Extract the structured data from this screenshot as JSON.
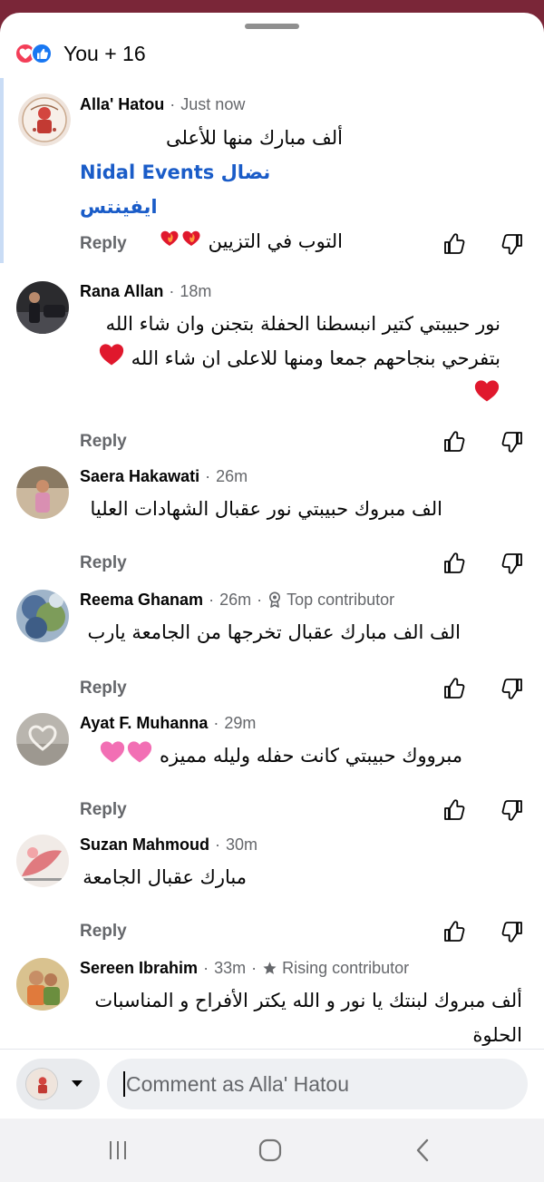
{
  "header": {
    "reactions_text": "You + 16",
    "reaction_icons": [
      "love-icon",
      "like-icon"
    ]
  },
  "comments": [
    {
      "author": "Alla' Hatou",
      "time": "Just now",
      "lines": [
        "ألف مبارك منها للأعلى"
      ],
      "mention": "Nidal Events نضال ايفينتس",
      "line_after": "التوب في التزيين",
      "emoji": [
        "❤️‍🔥",
        "❤️‍🔥"
      ],
      "reply": "Reply",
      "highlighted": true
    },
    {
      "author": "Rana Allan",
      "time": "18m",
      "lines": [
        "نور حبيبتي كتير انبسطنا الحفلة بتجنن وان شاء الله",
        "بتفرحي بنجاحهم جمعا ومنها للاعلى ان شاء الله"
      ],
      "emoji": [
        "❤️",
        "❤️"
      ],
      "reply": "Reply"
    },
    {
      "author": "Saera Hakawati",
      "time": "26m",
      "lines": [
        "الف مبروك حبيبتي نور عقبال الشهادات العليا"
      ],
      "reply": "Reply"
    },
    {
      "author": "Reema Ghanam",
      "time": "26m",
      "badge": "Top contributor",
      "lines": [
        "الف الف مبارك عقبال تخرجها من الجامعة يارب"
      ],
      "reply": "Reply"
    },
    {
      "author": "Ayat F. Muhanna",
      "time": "29m",
      "lines": [
        "مبرووك حبيبتي كانت حفله وليله مميزه"
      ],
      "emoji": [
        "💗",
        "💗"
      ],
      "reply": "Reply"
    },
    {
      "author": "Suzan Mahmoud",
      "time": "30m",
      "lines": [
        "مبارك عقبال الجامعة"
      ],
      "reply": "Reply"
    },
    {
      "author": "Sereen Ibrahim",
      "time": "33m",
      "badge": "Rising contributor",
      "lines": [
        "ألف مبروك لبنتك يا نور و الله يكتر الأفراح و المناسبات",
        "الحلوة"
      ]
    }
  ],
  "composer": {
    "placeholder": "Comment as Alla' Hatou"
  },
  "colors": {
    "accent_blue": "#1877f2",
    "mention_blue": "#1a5cc8",
    "love_red": "#f33e58",
    "muted_text": "#65676b",
    "top_bar": "#7a2638",
    "heart_red": "#e0182d",
    "heart_pink": "#f26fb4"
  }
}
